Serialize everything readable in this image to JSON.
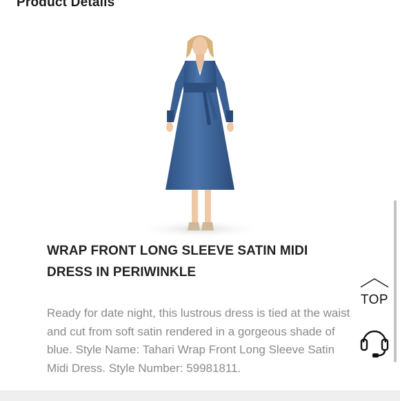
{
  "section": {
    "heading": "Product Details"
  },
  "product": {
    "title": "WRAP FRONT LONG SLEEVE SATIN MIDI DRESS IN PERIWINKLE",
    "description": "Ready for date night, this lustrous dress is tied at the waist and cut from soft satin rendered in a gorgeous shade of blue. Style Name: Tahari Wrap Front Long Sleeve Satin Midi Dress. Style Number: 59981811.",
    "image_icon": "dress-photo",
    "dress_color": "#3d6296"
  },
  "top_button": {
    "label": "TOP",
    "icon": "chevron-up-icon"
  },
  "support": {
    "icon": "headset-icon"
  }
}
